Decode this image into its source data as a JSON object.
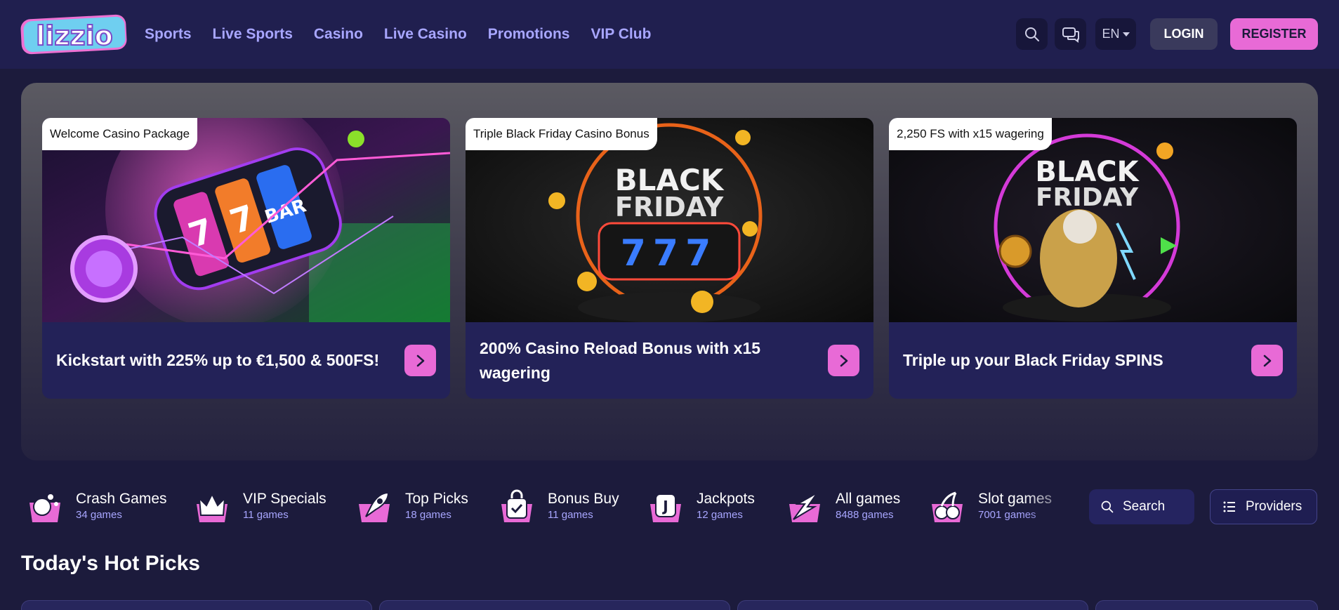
{
  "brand": {
    "logo_text": "lizzio"
  },
  "nav": {
    "items": [
      "Sports",
      "Live Sports",
      "Casino",
      "Live Casino",
      "Promotions",
      "VIP Club"
    ]
  },
  "header": {
    "language": "EN",
    "login_label": "LOGIN",
    "register_label": "REGISTER"
  },
  "promos": [
    {
      "tag": "Welcome Casino Package",
      "text": "Kickstart with 225% up to €1,500 & 500FS!"
    },
    {
      "tag": "Triple Black Friday Casino Bonus",
      "text": "200% Casino Reload Bonus with x15 wagering",
      "image_text": [
        "BLACK",
        "FRIDAY",
        "777"
      ]
    },
    {
      "tag": "2,250 FS with x15 wagering",
      "text": "Triple up your Black Friday SPINS",
      "image_text": [
        "BLACK",
        "FRIDAY"
      ]
    }
  ],
  "categories": [
    {
      "name": "Crash Games",
      "count": "34 games",
      "icon": "crash-games-icon"
    },
    {
      "name": "VIP Specials",
      "count": "11 games",
      "icon": "crown-icon"
    },
    {
      "name": "Top Picks",
      "count": "18 games",
      "icon": "rocket-icon"
    },
    {
      "name": "Bonus Buy",
      "count": "11 games",
      "icon": "shopping-bag-icon"
    },
    {
      "name": "Jackpots",
      "count": "12 games",
      "icon": "jackpot-icon"
    },
    {
      "name": "All games",
      "count": "8488 games",
      "icon": "lightning-icon"
    },
    {
      "name": "Slot games",
      "count": "7001 games",
      "icon": "cherries-icon"
    }
  ],
  "games_search": {
    "label": "Search"
  },
  "providers": {
    "label": "Providers"
  },
  "hot_picks": {
    "title": "Today's Hot Picks"
  },
  "colors": {
    "background": "#1c1b3c",
    "header": "#201f4f",
    "accent_pink": "#e86ad6",
    "nav_text": "#a8a6ff",
    "card_footer": "#232258"
  }
}
